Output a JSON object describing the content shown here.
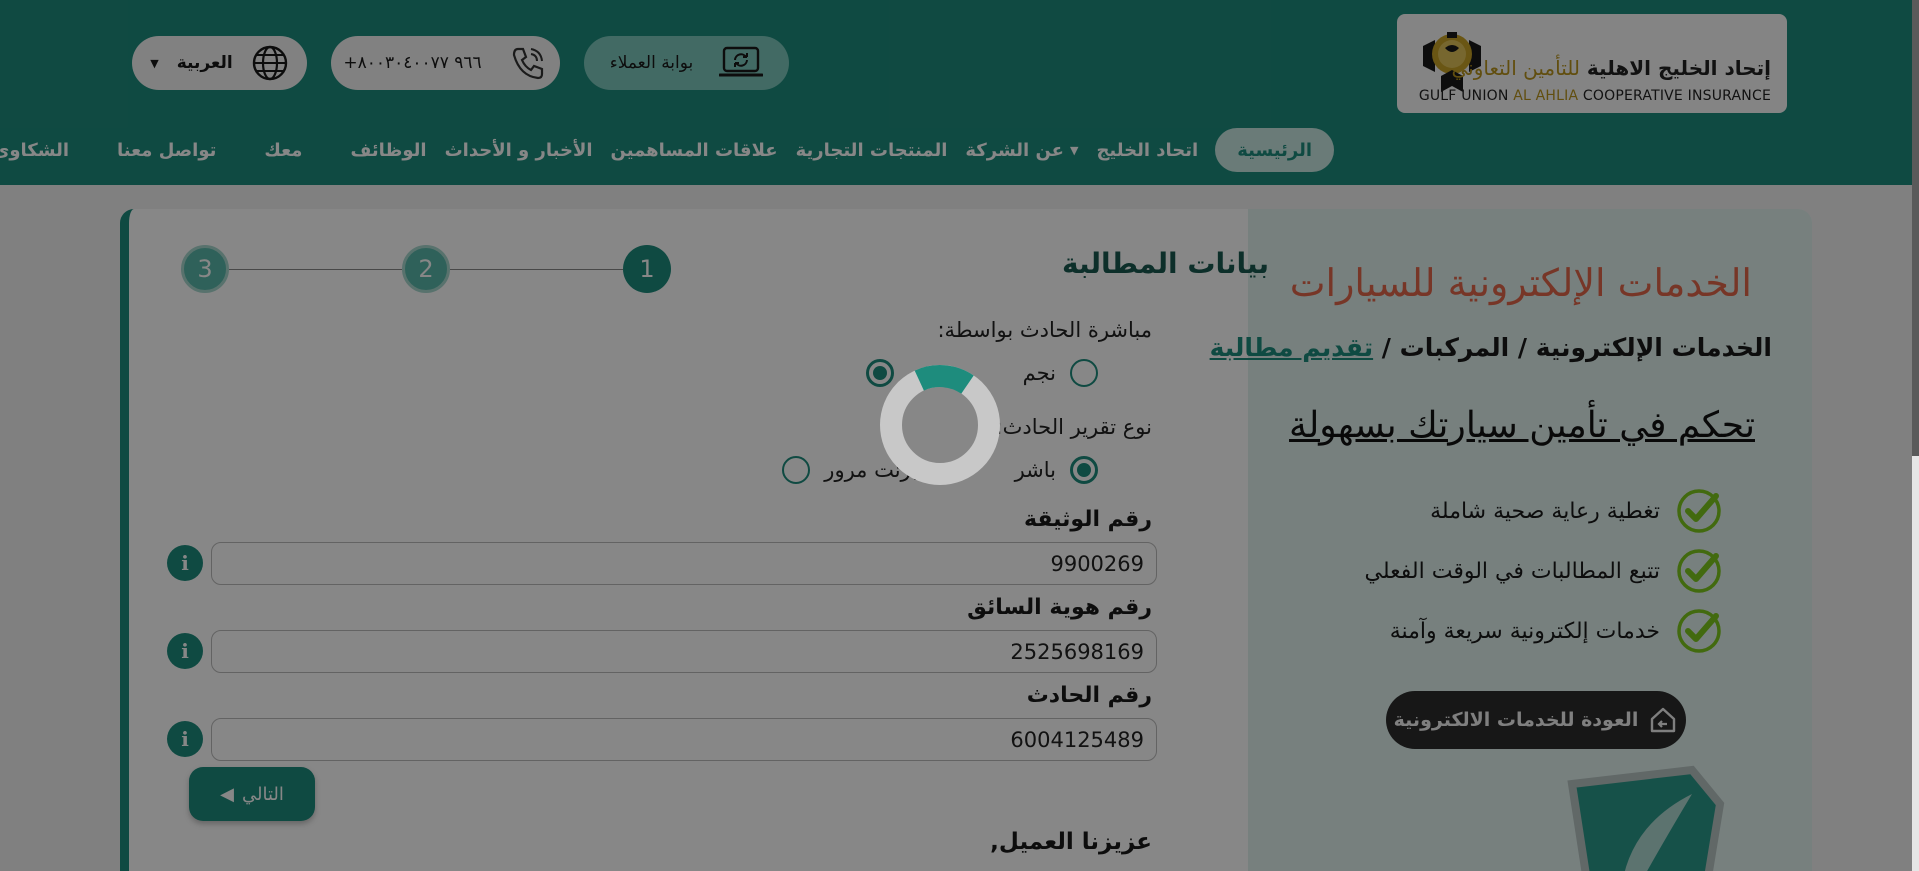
{
  "header": {
    "logo": {
      "arabic_bold": "إتحاد الخليج الاهلية",
      "arabic_light": "للتأمين التعاوني",
      "english_prefix": "GULF UNION",
      "english_gold": "AL AHLIA",
      "english_suffix": "COOPERATIVE INSURANCE"
    },
    "portal_label": "بوابة العملاء",
    "phone": "+٩٦٦ ٨٠٠٣٠٤٠٠٧٧",
    "language": "العربية"
  },
  "nav": {
    "items": [
      {
        "label": "الرئيسية",
        "active": true
      },
      {
        "label": "اتحاد الخليج"
      },
      {
        "label": "عن الشركة",
        "dropdown": true
      },
      {
        "label": "المنتجات التجارية"
      },
      {
        "label": "علاقات المساهمين"
      },
      {
        "label": "الأخبار و الأحداث"
      },
      {
        "label": "الوظائف"
      },
      {
        "label": "معك"
      },
      {
        "label": "تواصل معنا"
      },
      {
        "label": "الشكاوى"
      }
    ]
  },
  "side": {
    "title": "الخدمات الإلكترونية للسيارات",
    "breadcrumb": {
      "part1": "الخدمات الإلكترونية",
      "sep1": " / ",
      "part2": "المركبات",
      "sep2": " / ",
      "current": "تقديم مطالبة"
    },
    "tagline": "تحكم في تأمين سيارتك بسهولة",
    "features": [
      "تغطية رعاية صحية شاملة",
      "تتبع المطالبات في الوقت الفعلي",
      "خدمات إلكترونية سريعة وآمنة"
    ],
    "back_button": "العودة للخدمات الالكترونية"
  },
  "form": {
    "title": "بيانات المطالبة",
    "steps": [
      "1",
      "2",
      "3"
    ],
    "current_step": 1,
    "handled_by_label": "مباشرة الحادث بواسطة:",
    "handled_by_options": [
      "نجم",
      "مرور"
    ],
    "handled_by_selected": "مرور",
    "report_type_label": "نوع تقرير الحادث:",
    "report_type_options": [
      "باشر",
      "برنت مرور"
    ],
    "report_type_selected": "باشر",
    "policy_label": "رقم الوثيقة",
    "policy_value": "9900269",
    "driver_id_label": "رقم هوية السائق",
    "driver_id_value": "2525698169",
    "accident_label": "رقم الحادث",
    "accident_value": "6004125489",
    "next_button": "التالي",
    "greeting": "عزيزنا العميل,"
  },
  "colors": {
    "primary": "#1e8c7d",
    "accent": "#e0674a",
    "check": "#7dc81e"
  }
}
